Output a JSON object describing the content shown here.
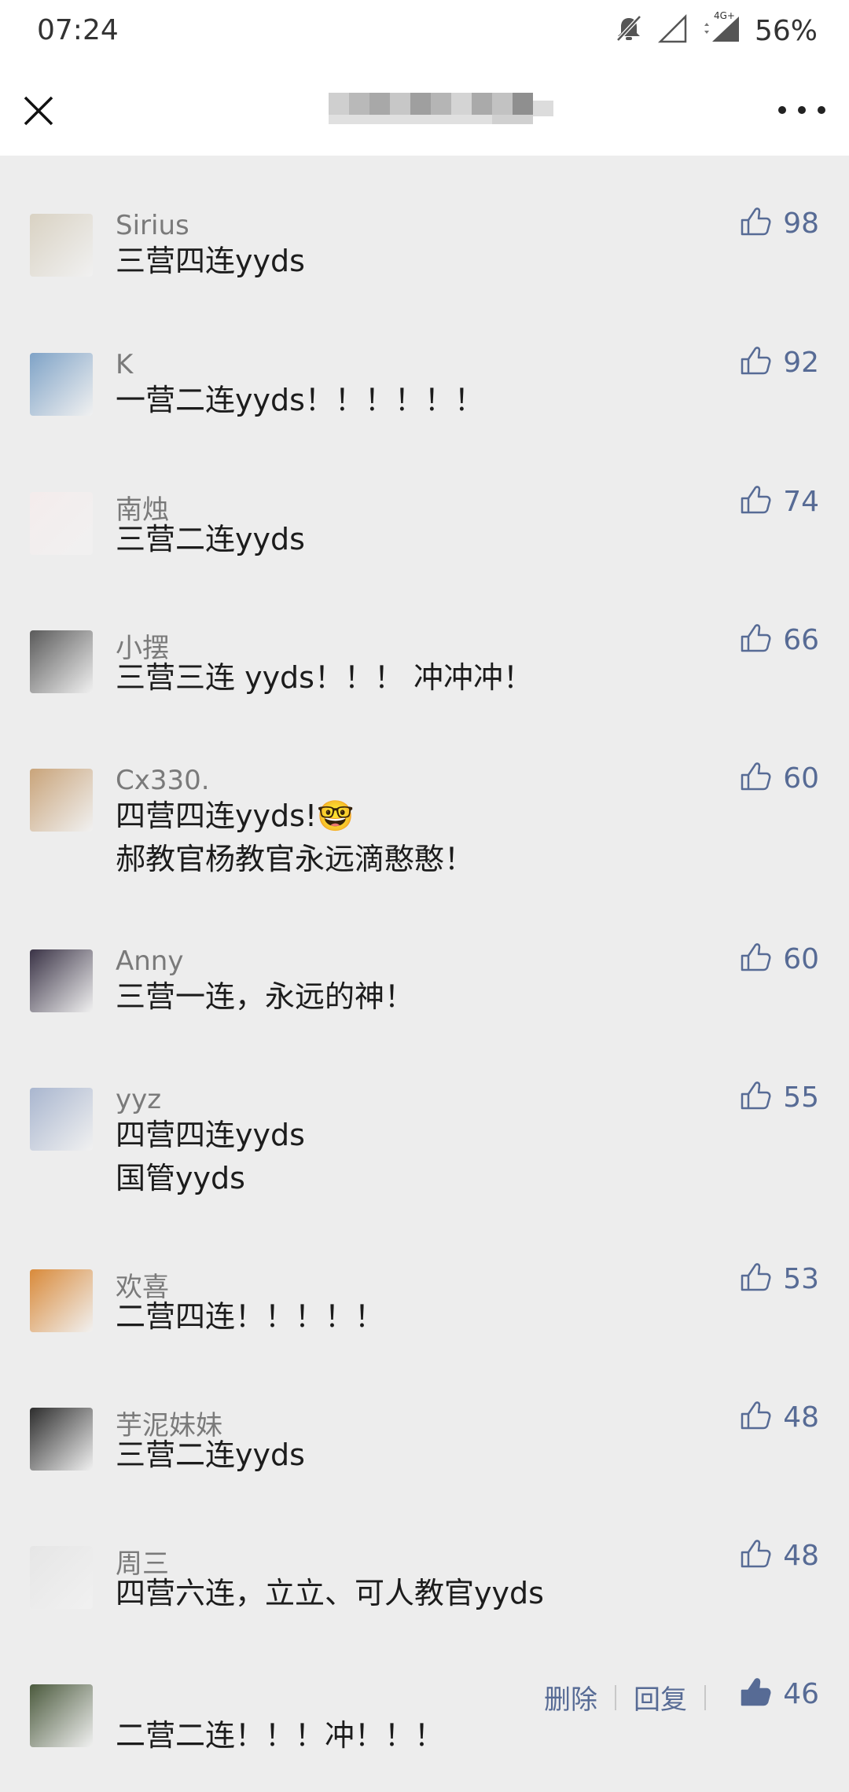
{
  "status": {
    "time": "07:24",
    "battery": "56%",
    "network": "4G+"
  },
  "nav": {
    "close_icon": "close-icon",
    "more_icon": "more-icon"
  },
  "comments": [
    {
      "name": "Sirius",
      "lines": [
        "三营四连yyds"
      ],
      "likes": "98",
      "avatar_color": "#d9d2c3"
    },
    {
      "name": "K",
      "lines": [
        "一营二连yyds！！！！！！"
      ],
      "likes": "92",
      "avatar_color": "#7fa3c7"
    },
    {
      "name": "南烛",
      "lines": [
        "三营二连yyds"
      ],
      "likes": "74",
      "avatar_color": "#f4ecec"
    },
    {
      "name": "小摆",
      "lines": [
        "三营三连 yyds！！！ 冲冲冲！"
      ],
      "likes": "66",
      "avatar_color": "#5a5a5a"
    },
    {
      "name": "Cx330.",
      "lines": [
        "四营四连yyds!🤓",
        "郝教官杨教官永远滴憨憨！"
      ],
      "likes": "60",
      "avatar_color": "#c9a47a"
    },
    {
      "name": "Anny",
      "lines": [
        "三营一连，永远的神！"
      ],
      "likes": "60",
      "avatar_color": "#3a3346"
    },
    {
      "name": "yyz",
      "lines": [
        "四营四连yyds",
        "国管yyds"
      ],
      "likes": "55",
      "avatar_color": "#a9b6cf"
    },
    {
      "name": "欢喜",
      "lines": [
        "二营四连！！！！！"
      ],
      "likes": "53",
      "avatar_color": "#d98a3a"
    },
    {
      "name": "芋泥妹妹",
      "lines": [
        "三营二连yyds"
      ],
      "likes": "48",
      "avatar_color": "#2d2d2d"
    },
    {
      "name": "周三",
      "lines": [
        "四营六连，立立、可人教官yyds"
      ],
      "likes": "48",
      "avatar_color": "#e6e6e6"
    },
    {
      "name": "",
      "lines": [
        "二营二连！！！冲！！！"
      ],
      "likes": "46",
      "avatar_color": "#4b5a3d",
      "own": true,
      "delete_label": "删除",
      "reply_label": "回复",
      "liked": true
    }
  ],
  "colors": {
    "link": "#576b95",
    "background": "#ededed"
  }
}
